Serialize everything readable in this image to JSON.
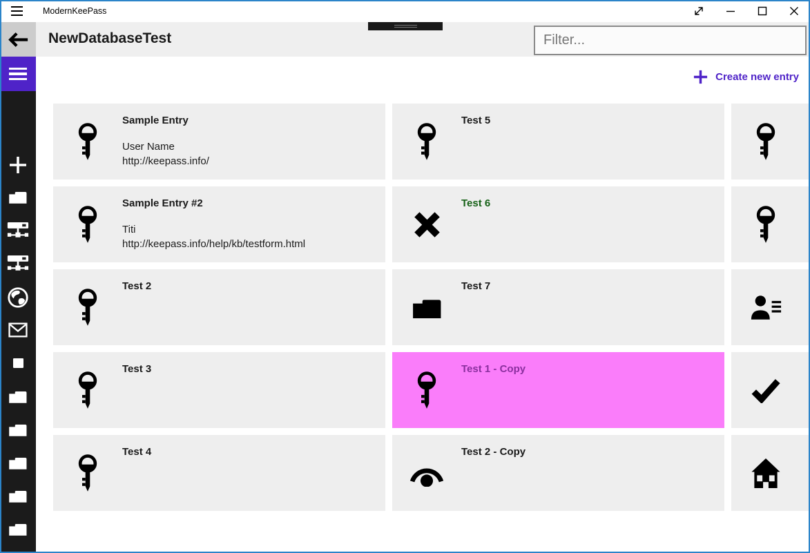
{
  "colors": {
    "accent": "#4f23c8",
    "window-border": "#2b84c9",
    "header-bg": "#efefef",
    "card-bg": "#eeeeee",
    "back-btn-bg": "#cccccc",
    "sidebar-bg": "#1b1b1b",
    "selected-bg": "#fa7dfa",
    "selected-title": "#8a2f9e",
    "green-title": "#166117"
  },
  "titlebar": {
    "app_title": "ModernKeePass",
    "control_icons": [
      "fullscreen",
      "minimize",
      "maximize",
      "close"
    ]
  },
  "header": {
    "page_title": "NewDatabaseTest",
    "filter_placeholder": "Filter..."
  },
  "actions": {
    "create_new_entry": "Create new entry"
  },
  "sidebar": {
    "icons": [
      "menu",
      "add",
      "folder",
      "server-network",
      "server-network",
      "globe",
      "mail",
      "square",
      "folder",
      "folder",
      "folder",
      "folder",
      "folder"
    ]
  },
  "entries": [
    {
      "icon": "key",
      "title": "Sample Entry",
      "line1": "User Name",
      "line2": "http://keepass.info/"
    },
    {
      "icon": "key",
      "title": "Sample Entry #2",
      "line1": "Titi",
      "line2": "http://keepass.info/help/kb/testform.html"
    },
    {
      "icon": "key",
      "title": "Test 2"
    },
    {
      "icon": "key",
      "title": "Test 3"
    },
    {
      "icon": "key",
      "title": "Test 4"
    },
    {
      "icon": "key",
      "title": "Test 5"
    },
    {
      "icon": "x-cross",
      "title": "Test 6",
      "title_color": "green"
    },
    {
      "icon": "folder",
      "title": "Test 7"
    },
    {
      "icon": "key",
      "title": "Test 1 - Copy",
      "selected": true
    },
    {
      "icon": "red-eye",
      "title": "Test 2 - Copy"
    },
    {
      "icon": "key",
      "title": ""
    },
    {
      "icon": "key",
      "title": ""
    },
    {
      "icon": "contact-list",
      "title": ""
    },
    {
      "icon": "checkmark",
      "title": ""
    },
    {
      "icon": "home",
      "title": ""
    }
  ]
}
